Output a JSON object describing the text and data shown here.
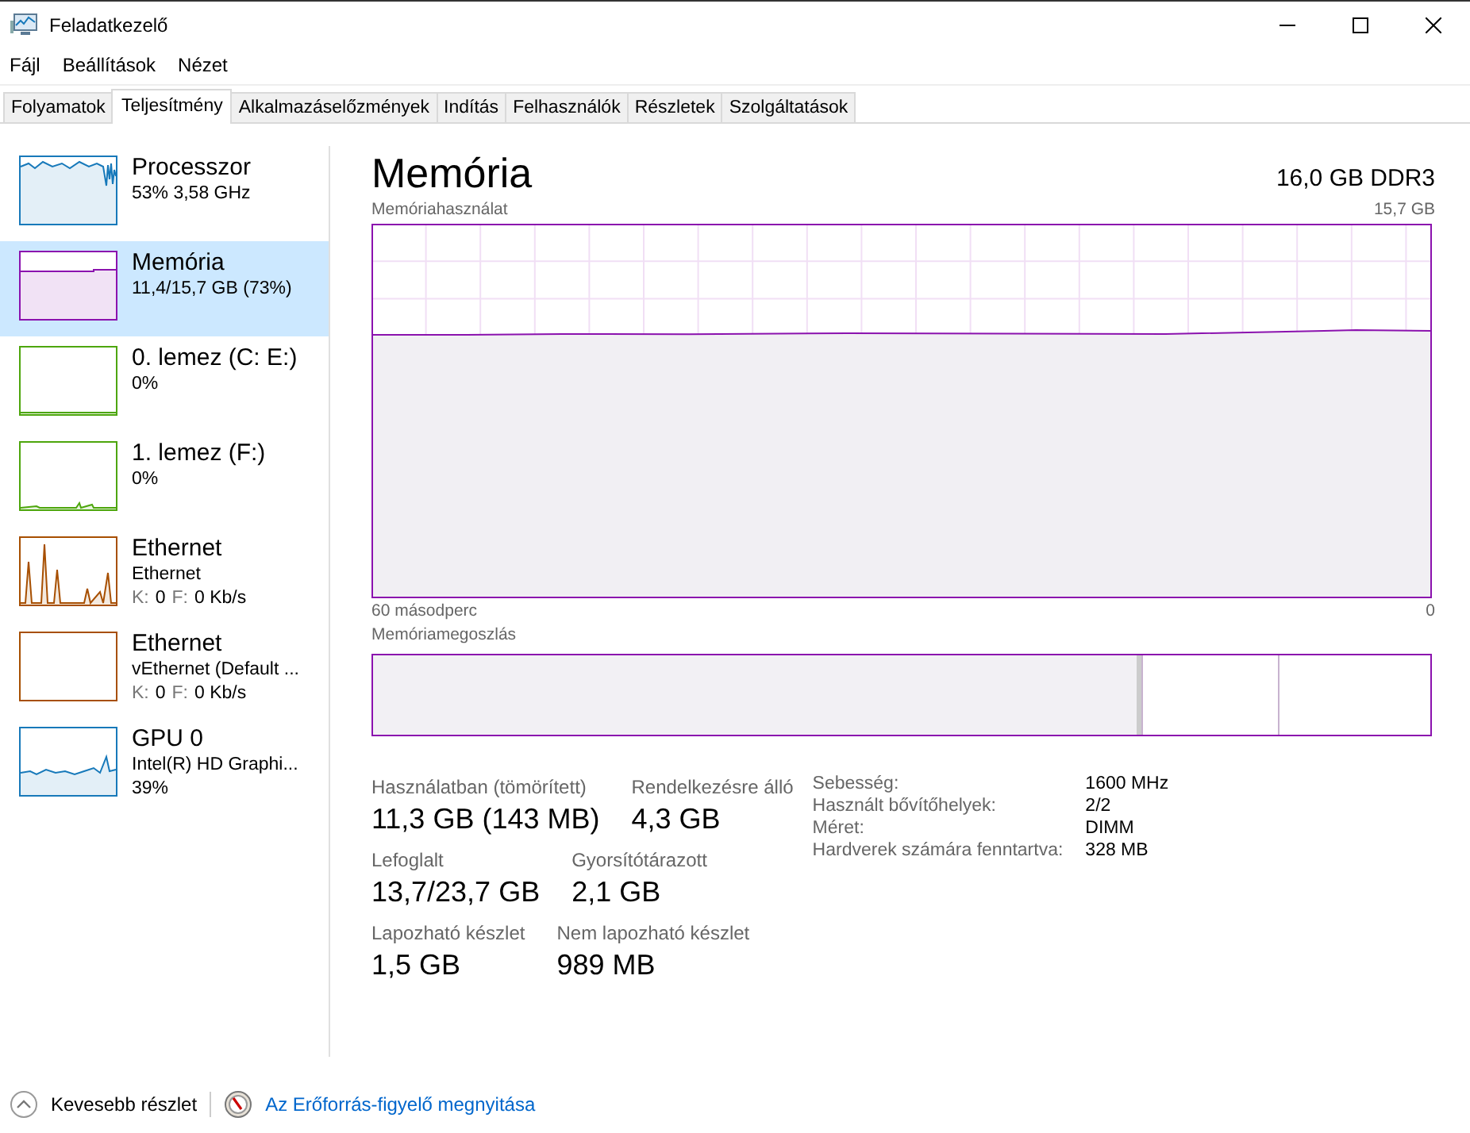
{
  "window": {
    "title": "Feladatkezelő"
  },
  "menu": [
    "Fájl",
    "Beállítások",
    "Nézet"
  ],
  "tabs": [
    {
      "label": "Folyamatok",
      "selected": false
    },
    {
      "label": "Teljesítmény",
      "selected": true
    },
    {
      "label": "Alkalmazáselőzmények",
      "selected": false
    },
    {
      "label": "Indítás",
      "selected": false
    },
    {
      "label": "Felhasználók",
      "selected": false
    },
    {
      "label": "Részletek",
      "selected": false
    },
    {
      "label": "Szolgáltatások",
      "selected": false
    }
  ],
  "sidebar": {
    "items": [
      {
        "kind": "cpu",
        "title": "Processzor",
        "color": "#1779ba",
        "selected": false,
        "lines": [
          [
            {
              "text": "53%  3,58 GHz",
              "muted": false
            }
          ]
        ]
      },
      {
        "kind": "memory",
        "title": "Memória",
        "color": "#8b12ae",
        "selected": true,
        "lines": [
          [
            {
              "text": "11,4/15,7 GB (73%)",
              "muted": false
            }
          ]
        ]
      },
      {
        "kind": "disk",
        "title": "0. lemez (C: E:)",
        "color": "#4da60c",
        "selected": false,
        "lines": [
          [
            {
              "text": "0%",
              "muted": false
            }
          ]
        ]
      },
      {
        "kind": "disk",
        "title": "1. lemez (F:)",
        "color": "#4da60c",
        "selected": false,
        "lines": [
          [
            {
              "text": "0%",
              "muted": false
            }
          ]
        ]
      },
      {
        "kind": "network",
        "title": "Ethernet",
        "color": "#a74f01",
        "selected": false,
        "lines": [
          [
            {
              "text": "Ethernet",
              "muted": false
            }
          ],
          [
            {
              "text": "K:",
              "muted": true
            },
            {
              "text": "0",
              "muted": false
            },
            {
              "text": "F:",
              "muted": true
            },
            {
              "text": "0 Kb/s",
              "muted": false
            }
          ]
        ]
      },
      {
        "kind": "idle",
        "title": "Ethernet",
        "color": "#a74f01",
        "selected": false,
        "lines": [
          [
            {
              "text": "vEthernet (Default ...",
              "muted": false
            }
          ],
          [
            {
              "text": "K:",
              "muted": true
            },
            {
              "text": "0",
              "muted": false
            },
            {
              "text": "F:",
              "muted": true
            },
            {
              "text": "0 Kb/s",
              "muted": false
            }
          ]
        ]
      },
      {
        "kind": "gpu",
        "title": "GPU 0",
        "color": "#1779ba",
        "selected": false,
        "lines": [
          [
            {
              "text": "Intel(R) HD Graphi...",
              "muted": false
            }
          ],
          [
            {
              "text": "39%",
              "muted": false
            }
          ]
        ]
      }
    ]
  },
  "main": {
    "title": "Memória",
    "subtitle": "16,0 GB DDR3",
    "usage_graph": {
      "label": "Memóriahasználat",
      "max_label": "15,7 GB",
      "time_label": "60 másodperc",
      "min_label": "0"
    },
    "composition": {
      "label": "Memóriamegoszlás"
    },
    "stats": [
      [
        {
          "label": "Használatban (tömörített)",
          "value": "11,3 GB (143 MB)"
        },
        {
          "label": "Rendelkezésre álló",
          "value": "4,3 GB"
        }
      ],
      [
        {
          "label": "Lefoglalt",
          "value": "13,7/23,7 GB"
        },
        {
          "label": "Gyorsítótárazott",
          "value": "2,1 GB"
        }
      ],
      [
        {
          "label": "Lapozható készlet",
          "value": "1,5 GB"
        },
        {
          "label": "Nem lapozható készlet",
          "value": "989 MB"
        }
      ]
    ],
    "properties": [
      {
        "label": "Sebesség:",
        "value": "1600 MHz"
      },
      {
        "label": "Használt bővítőhelyek:",
        "value": "2/2"
      },
      {
        "label": "Méret:",
        "value": "DIMM"
      },
      {
        "label": "Hardverek számára fenntartva:",
        "value": "328 MB"
      }
    ]
  },
  "footer": {
    "details_button": "Kevesebb részlet",
    "monitor_link": "Az Erőforrás-figyelő megnyitása"
  }
}
